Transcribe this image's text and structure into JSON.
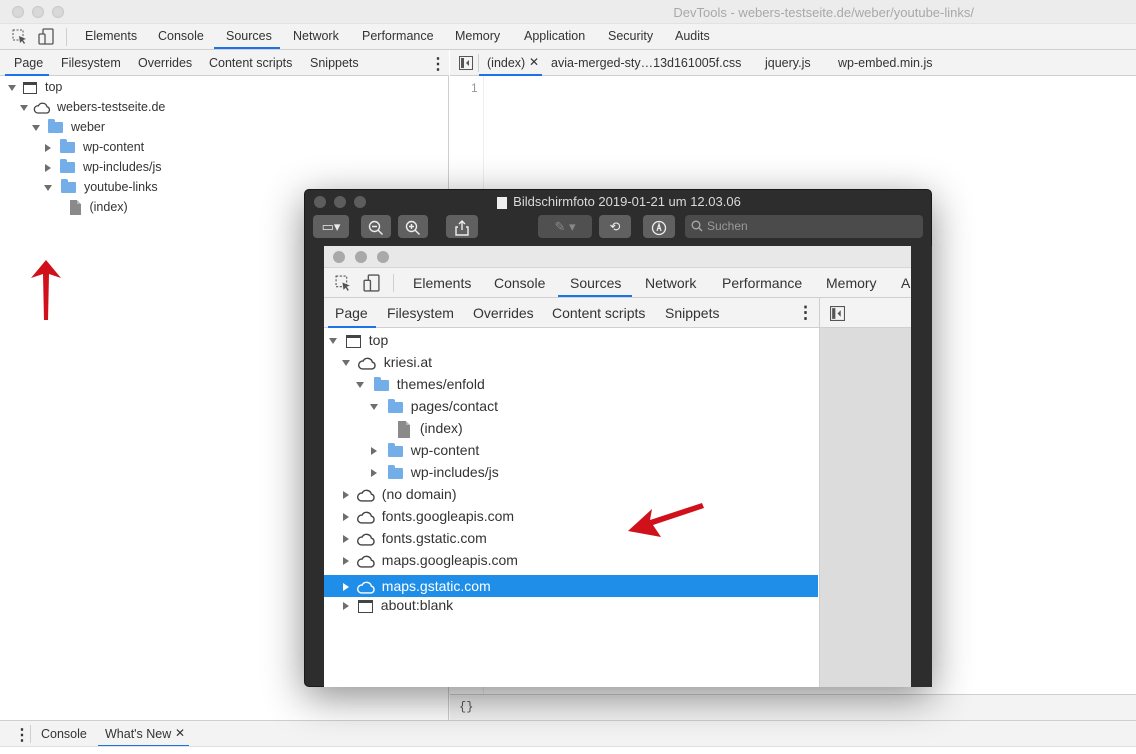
{
  "window": {
    "title": "DevTools - webers-testseite.de/weber/youtube-links/"
  },
  "main_tabs": [
    "Elements",
    "Console",
    "Sources",
    "Network",
    "Performance",
    "Memory",
    "Application",
    "Security",
    "Audits"
  ],
  "active_main_tab": "Sources",
  "navigator_tabs": [
    "Page",
    "Filesystem",
    "Overrides",
    "Content scripts",
    "Snippets"
  ],
  "tree": [
    {
      "label": "top",
      "icon": "frame-icon"
    },
    {
      "label": "webers-testseite.de",
      "icon": "cloud-icon"
    },
    {
      "label": "weber",
      "icon": "folder-icon"
    },
    {
      "label": "wp-content",
      "icon": "folder-icon"
    },
    {
      "label": "wp-includes/js",
      "icon": "folder-icon"
    },
    {
      "label": "youtube-links",
      "icon": "folder-icon"
    },
    {
      "label": "(index)",
      "icon": "file-icon"
    }
  ],
  "editor_tabs": [
    "(index)",
    "avia-merged-sty…13d161005f.css",
    "jquery.js",
    "wp-embed.min.js"
  ],
  "editor": {
    "line_number": "1"
  },
  "bottom_bar": {
    "format_icon": "{}"
  },
  "drawer_tabs": [
    "Console",
    "What's New"
  ],
  "preview": {
    "title": "Bildschirmfoto 2019-01-21 um 12.03.06",
    "search_placeholder": "Suchen",
    "shot": {
      "main_tabs": [
        "Elements",
        "Console",
        "Sources",
        "Network",
        "Performance",
        "Memory",
        "Ap"
      ],
      "navigator_tabs": [
        "Page",
        "Filesystem",
        "Overrides",
        "Content scripts",
        "Snippets"
      ],
      "tree": [
        {
          "label": "top",
          "icon": "frame-icon"
        },
        {
          "label": "kriesi.at",
          "icon": "cloud-icon"
        },
        {
          "label": "themes/enfold",
          "icon": "folder-icon"
        },
        {
          "label": "pages/contact",
          "icon": "folder-icon"
        },
        {
          "label": "(index)",
          "icon": "file-icon"
        },
        {
          "label": "wp-content",
          "icon": "folder-icon"
        },
        {
          "label": "wp-includes/js",
          "icon": "folder-icon"
        },
        {
          "label": "(no domain)",
          "icon": "cloud-icon"
        },
        {
          "label": "fonts.googleapis.com",
          "icon": "cloud-icon"
        },
        {
          "label": "fonts.gstatic.com",
          "icon": "cloud-icon"
        },
        {
          "label": "maps.googleapis.com",
          "icon": "cloud-icon"
        },
        {
          "label": "maps.gstatic.com",
          "icon": "cloud-icon"
        },
        {
          "label": "about:blank",
          "icon": "frame-icon"
        }
      ],
      "selected_item": "maps.gstatic.com"
    }
  },
  "colors": {
    "accent": "#1a73e8",
    "selection": "#1e8ee8",
    "annotation_arrow": "#d0111b"
  }
}
